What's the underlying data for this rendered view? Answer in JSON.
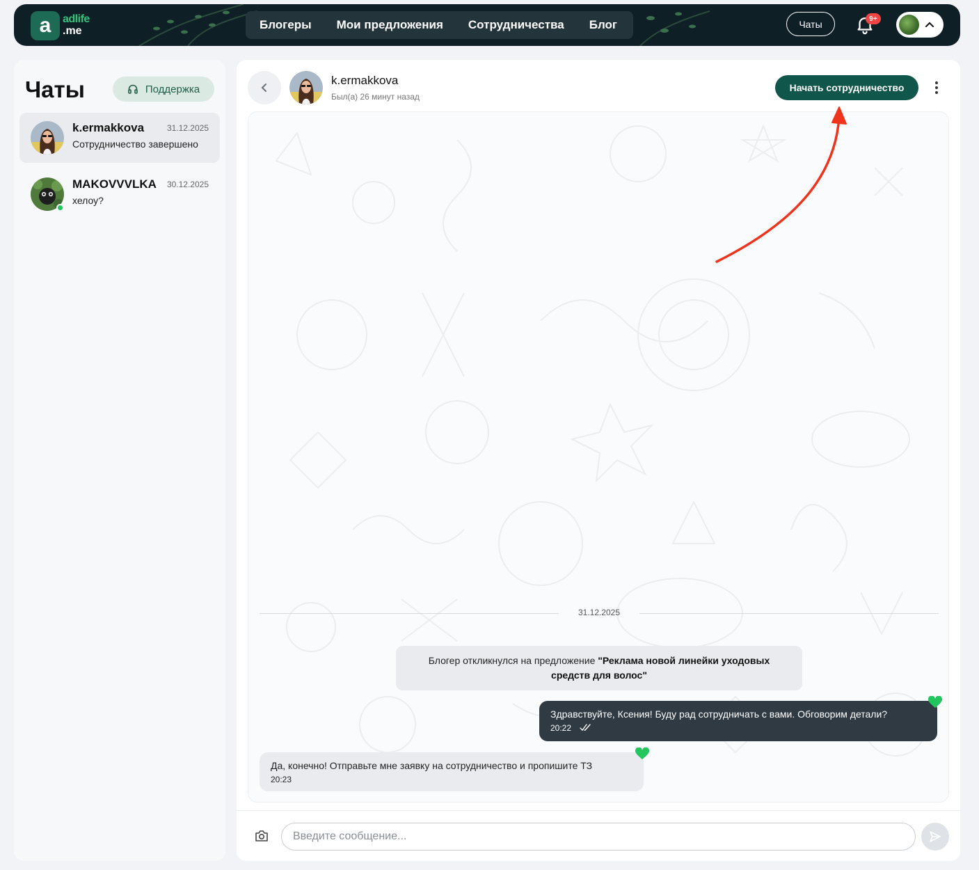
{
  "header": {
    "logo_line1": "adlife",
    "logo_line2": ".me",
    "logo_letter": "a",
    "nav": [
      {
        "label": "Блогеры"
      },
      {
        "label": "Мои предложения"
      },
      {
        "label": "Сотрудничества"
      },
      {
        "label": "Блог"
      }
    ],
    "chats_label": "Чаты",
    "notifications_badge": "9+"
  },
  "sidebar": {
    "title": "Чаты",
    "support_label": "Поддержка",
    "chats": [
      {
        "name": "k.ermakkova",
        "date": "31.12.2025",
        "preview": "Сотрудничество завершено",
        "active": true,
        "online": false
      },
      {
        "name": "MAKOVVVLKA",
        "date": "30.12.2025",
        "preview": "хелоу?",
        "active": false,
        "online": true
      }
    ]
  },
  "conversation": {
    "name": "k.ermakkova",
    "status": "Был(а) 26 минут назад",
    "start_button": "Начать сотрудничество",
    "date_separator": "31.12.2025",
    "system_message": {
      "prefix": "Блогер откликнулся на предложение ",
      "offer": "\"Реклама новой линейки уходовых средств для волос\""
    },
    "messages": [
      {
        "direction": "out",
        "text": "Здравствуйте, Ксения! Буду рад сотрудничать с вами. Обговорим детали?",
        "time": "20:22"
      },
      {
        "direction": "in",
        "text": "Да, конечно! Отправьте мне заявку на сотрудничество и пропишите ТЗ",
        "time": "20:23"
      }
    ],
    "input_placeholder": "Введите сообщение..."
  },
  "colors": {
    "brand_green": "#10564a",
    "header_bg": "#0f1f26",
    "outgoing_bubble": "#2f3a42",
    "incoming_bubble": "#e9ebef",
    "online": "#1ec75d",
    "badge": "#f04545",
    "annotation_arrow": "#f0331c"
  },
  "icons": [
    "back-chevron-icon",
    "headphones-icon",
    "bell-icon",
    "chevron-up-icon",
    "kebab-icon",
    "double-check-icon",
    "heart-icon",
    "camera-icon",
    "send-icon"
  ]
}
